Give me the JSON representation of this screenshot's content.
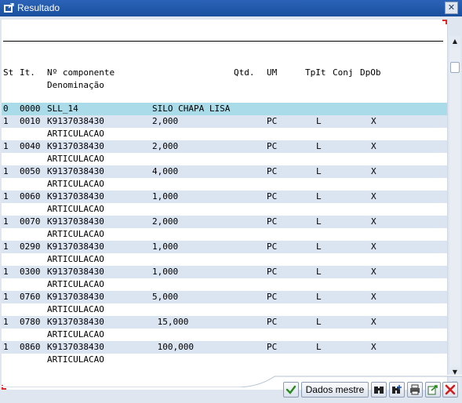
{
  "window": {
    "title": "Resultado",
    "close_label": "✕"
  },
  "header": {
    "st": "St",
    "it": "It.",
    "componente": "Nº componente",
    "denominacao": "Denominação",
    "qtd": "Qtd.",
    "um": "UM",
    "tpit": "TpIt",
    "conj": "Conj",
    "dpob": "DpOb"
  },
  "rows": [
    {
      "st": "0",
      "it": "0000",
      "comp": "SLL_14",
      "qtd": "SILO CHAPA LISA",
      "um": "",
      "tp": "",
      "dp": "",
      "desc": ""
    },
    {
      "st": "1",
      "it": "0010",
      "comp": "K9137038430",
      "qtd": "2,000",
      "um": "PC",
      "tp": "L",
      "dp": "X",
      "desc": "ARTICULACAO"
    },
    {
      "st": "1",
      "it": "0040",
      "comp": "K9137038430",
      "qtd": "2,000",
      "um": "PC",
      "tp": "L",
      "dp": "X",
      "desc": "ARTICULACAO"
    },
    {
      "st": "1",
      "it": "0050",
      "comp": "K9137038430",
      "qtd": "4,000",
      "um": "PC",
      "tp": "L",
      "dp": "X",
      "desc": "ARTICULACAO"
    },
    {
      "st": "1",
      "it": "0060",
      "comp": "K9137038430",
      "qtd": "1,000",
      "um": "PC",
      "tp": "L",
      "dp": "X",
      "desc": "ARTICULACAO"
    },
    {
      "st": "1",
      "it": "0070",
      "comp": "K9137038430",
      "qtd": "2,000",
      "um": "PC",
      "tp": "L",
      "dp": "X",
      "desc": "ARTICULACAO"
    },
    {
      "st": "1",
      "it": "0290",
      "comp": "K9137038430",
      "qtd": "1,000",
      "um": "PC",
      "tp": "L",
      "dp": "X",
      "desc": "ARTICULACAO"
    },
    {
      "st": "1",
      "it": "0300",
      "comp": "K9137038430",
      "qtd": "1,000",
      "um": "PC",
      "tp": "L",
      "dp": "X",
      "desc": "ARTICULACAO"
    },
    {
      "st": "1",
      "it": "0760",
      "comp": "K9137038430",
      "qtd": "5,000",
      "um": "PC",
      "tp": "L",
      "dp": "X",
      "desc": "ARTICULACAO"
    },
    {
      "st": "1",
      "it": "0780",
      "comp": "K9137038430",
      "qtd": " 15,000",
      "um": "PC",
      "tp": "L",
      "dp": "X",
      "desc": "ARTICULACAO"
    },
    {
      "st": "1",
      "it": "0860",
      "comp": "K9137038430",
      "qtd": " 100,000",
      "um": "PC",
      "tp": "L",
      "dp": "X",
      "desc": "ARTICULACAO"
    }
  ],
  "toolbar": {
    "ok_icon": "check-icon",
    "master_label": "Dados mestre",
    "find_icon": "binoculars-icon",
    "find_next_icon": "binoculars-plus-icon",
    "print_icon": "printer-icon",
    "export_icon": "export-icon",
    "cancel_icon": "cancel-x-icon"
  },
  "colors": {
    "title_bg": "#1f57a8",
    "row_blue": "#dbe4f1",
    "row_highlight": "#a9dbe9",
    "frame_bg": "#dfe6ef"
  }
}
